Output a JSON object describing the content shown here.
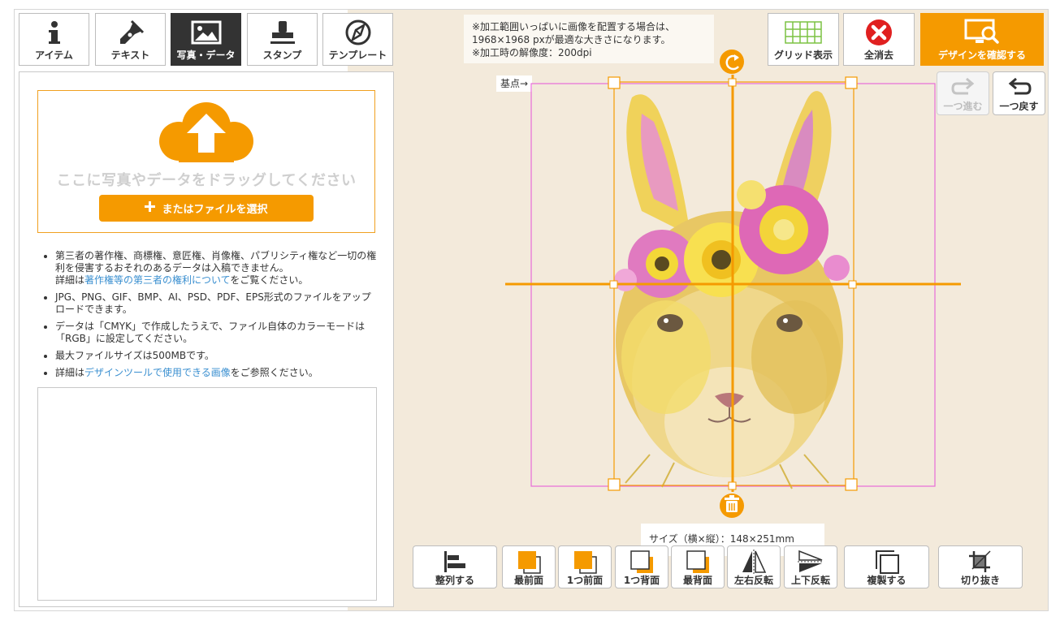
{
  "tabs": [
    {
      "label": "アイテム",
      "icon": "info-icon",
      "active": false
    },
    {
      "label": "テキスト",
      "icon": "pen-icon",
      "active": false
    },
    {
      "label": "写真・データ",
      "icon": "image-icon",
      "active": true
    },
    {
      "label": "スタンプ",
      "icon": "stamp-icon",
      "active": false
    },
    {
      "label": "テンプレート",
      "icon": "template-icon",
      "active": false
    }
  ],
  "upload": {
    "drop_text": "ここに写真やデータをドラッグしてください",
    "select_button": "またはファイルを選択"
  },
  "notes": {
    "n1_text": "第三者の著作権、商標権、意匠権、肖像権、パブリシティ権など一切の権利を侵害するおそれのあるデータは入稿できません。",
    "n1_prefix": "詳細は",
    "n1_link": "著作権等の第三者の権利について",
    "n1_suffix": "をご覧ください。",
    "n2": "JPG、PNG、GIF、BMP、AI、PSD、PDF、EPS形式のファイルをアップロードできます。",
    "n3": "データは「CMYK」で作成したうえで、ファイル自体のカラーモードは「RGB」に設定してください。",
    "n4": "最大ファイルサイズは500MBです。",
    "n5_prefix": "詳細は",
    "n5_link": "デザインツールで使用できる画像",
    "n5_suffix": "をご参照ください。"
  },
  "info": {
    "line1": "※加工範囲いっぱいに画像を配置する場合は、",
    "line2": "1968×1968 pxが最適な大きさになります。",
    "line3": "※加工時の解像度：200dpi"
  },
  "toolbar": {
    "grid": "グリッド表示",
    "clear": "全消去",
    "confirm": "デザインを確認する",
    "redo": "一つ進む",
    "undo": "一つ戻す"
  },
  "canvas": {
    "origin_label": "基点→",
    "size_text": "サイズ（横×縦）：148×251mm"
  },
  "bottom": {
    "align": "整列する",
    "front": "最前面",
    "forward": "1つ前面",
    "backward": "1つ背面",
    "back": "最背面",
    "flip_h": "左右反転",
    "flip_v": "上下反転",
    "duplicate": "複製する",
    "crop": "切り抜き"
  },
  "colors": {
    "accent": "#f59a00",
    "dark_tab": "#333333",
    "link": "#3a8fd0",
    "guide": "#e86bd8"
  }
}
